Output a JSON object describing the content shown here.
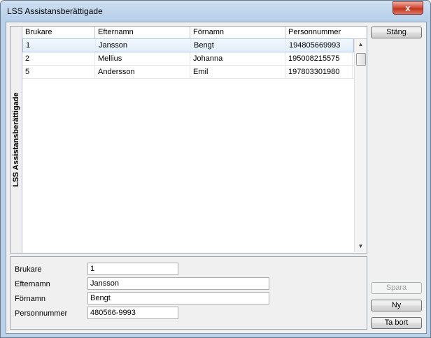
{
  "window": {
    "title": "LSS Assistansberättigade",
    "close_glyph": "x"
  },
  "grid": {
    "side_label": "LSS Assistansberättigade",
    "columns": [
      "Brukare",
      "Efternamn",
      "Förnamn",
      "Personnummer"
    ],
    "rows": [
      {
        "brukare": "1",
        "efternamn": "Jansson",
        "fornamn": "Bengt",
        "personnummer": "194805669993"
      },
      {
        "brukare": "2",
        "efternamn": "Mellius",
        "fornamn": "Johanna",
        "personnummer": "195008215575"
      },
      {
        "brukare": "5",
        "efternamn": "Andersson",
        "fornamn": "Emil",
        "personnummer": "197803301980"
      }
    ],
    "scroll_up_glyph": "▲",
    "scroll_down_glyph": "▼"
  },
  "form": {
    "brukare_label": "Brukare",
    "brukare_value": "1",
    "efternamn_label": "Efternamn",
    "efternamn_value": "Jansson",
    "fornamn_label": "Förnamn",
    "fornamn_value": "Bengt",
    "personnummer_label": "Personnummer",
    "personnummer_value": "480566-9993"
  },
  "buttons": {
    "stang": "Stäng",
    "spara": "Spara",
    "ny": "Ny",
    "ta_bort": "Ta bort"
  }
}
